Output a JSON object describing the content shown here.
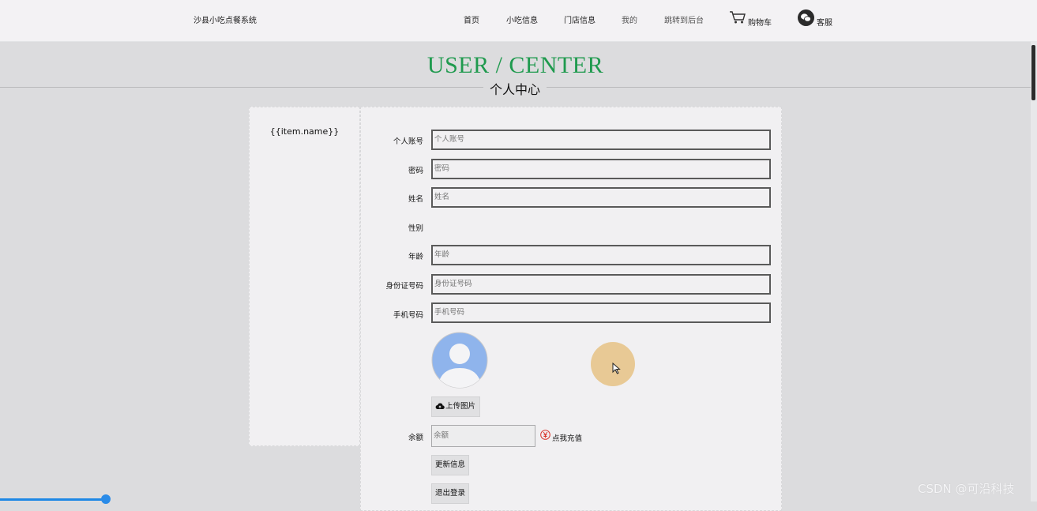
{
  "site": {
    "title": "沙县小吃点餐系统"
  },
  "nav": {
    "home": "首页",
    "snacks": "小吃信息",
    "stores": "门店信息",
    "mine": "我的",
    "backend": "跳转到后台",
    "cart": "购物车",
    "service": "客服"
  },
  "hero": {
    "title": "USER / CENTER",
    "subtitle": "个人中心"
  },
  "sidebar": {
    "item": "{{item.name}}"
  },
  "form": {
    "account_label": "个人账号",
    "account_placeholder": "个人账号",
    "password_label": "密码",
    "password_placeholder": "密码",
    "name_label": "姓名",
    "name_placeholder": "姓名",
    "gender_label": "性别",
    "age_label": "年龄",
    "age_placeholder": "年龄",
    "idcard_label": "身份证号码",
    "idcard_placeholder": "身份证号码",
    "phone_label": "手机号码",
    "phone_placeholder": "手机号码",
    "upload_label": "上传图片",
    "balance_label": "余额",
    "balance_placeholder": "余额",
    "recharge_label": "点我充值",
    "update_label": "更新信息",
    "logout_label": "退出登录"
  },
  "watermark": "CSDN @可沿科技",
  "colors": {
    "accent_green": "#1f9a4e",
    "yen_red": "#d9342b",
    "avatar_blue": "#8fb4ec"
  }
}
